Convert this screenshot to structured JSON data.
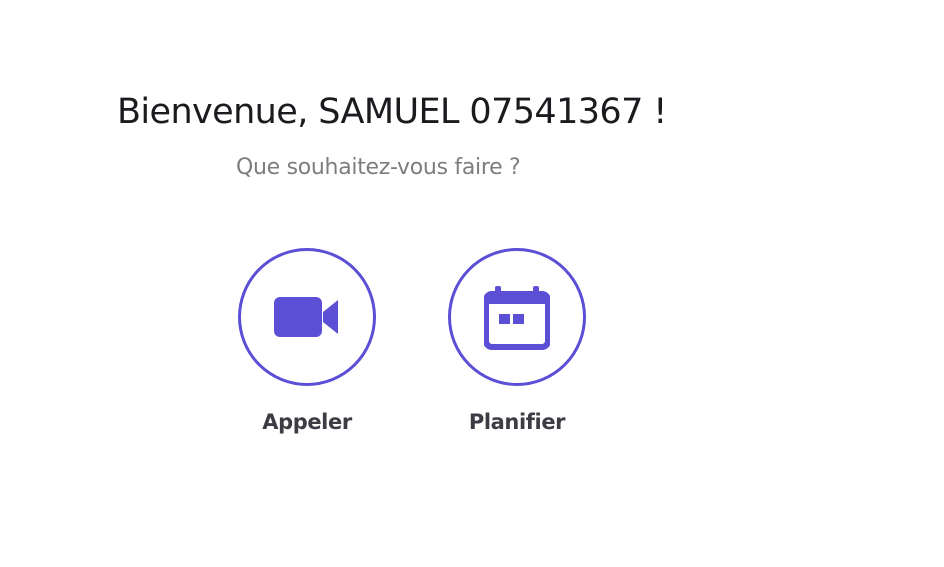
{
  "welcome": {
    "greeting": "Bienvenue, SAMUEL 07541367 !",
    "question": "Que souhaitez-vous faire ?"
  },
  "actions": [
    {
      "label": "Appeler",
      "icon": "video-camera-icon"
    },
    {
      "label": "Planifier",
      "icon": "calendar-icon"
    }
  ],
  "colors": {
    "accent": "#5b4fd6",
    "title": "#1b1b1f",
    "subtitle": "#7d7d7d",
    "label": "#3c3c44",
    "background": "#ffffff"
  }
}
